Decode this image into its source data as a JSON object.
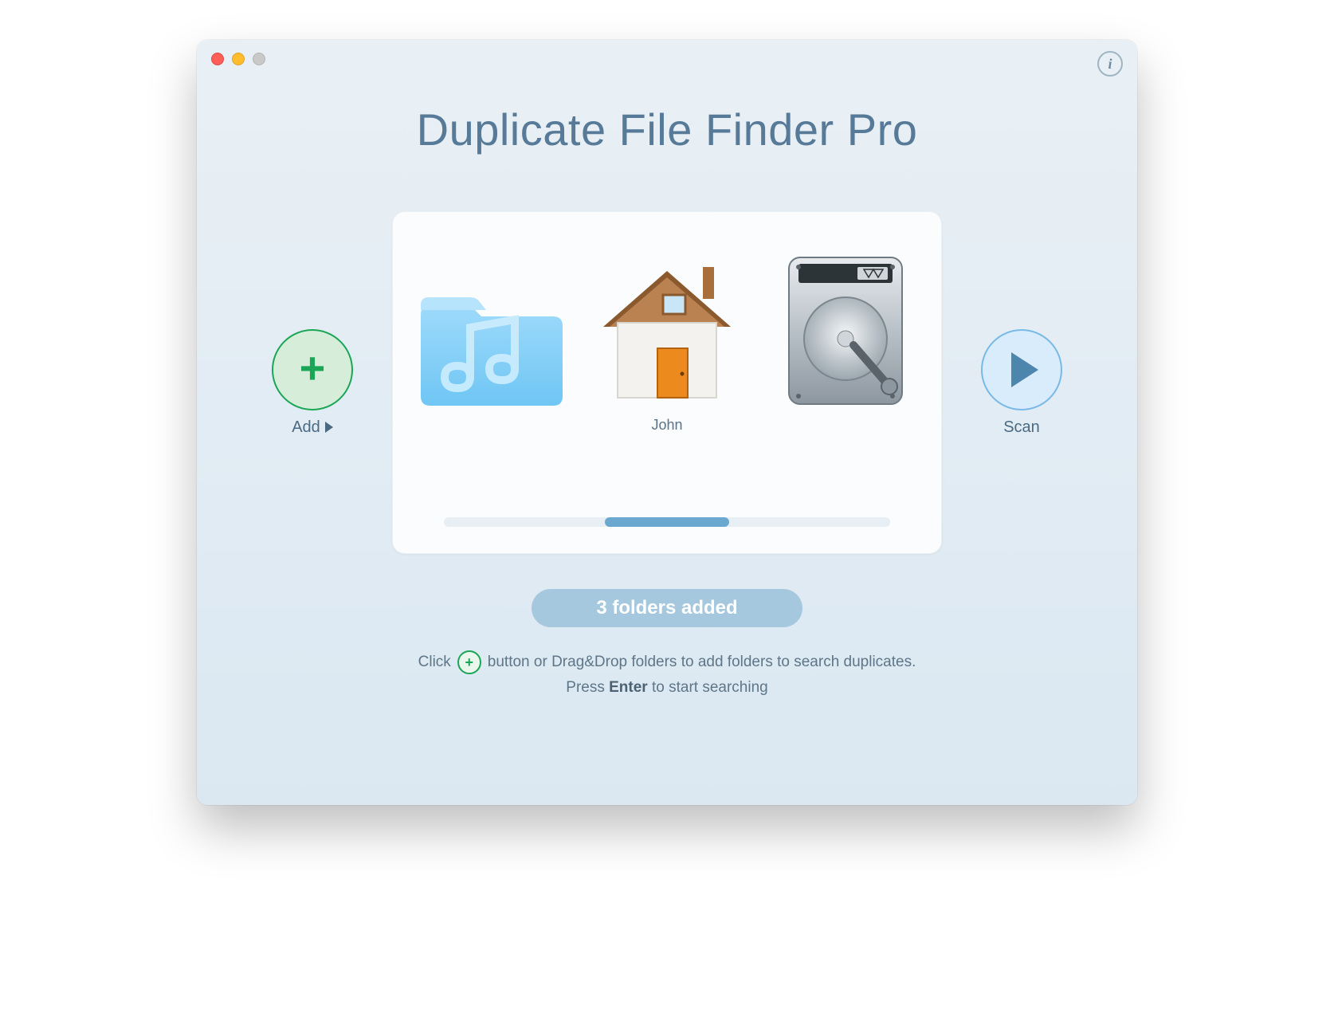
{
  "window": {
    "title": "Duplicate File Finder Pro"
  },
  "buttons": {
    "add_label": "Add",
    "scan_label": "Scan"
  },
  "card": {
    "items": [
      {
        "label": "",
        "type": "music-folder"
      },
      {
        "label": "John",
        "type": "home"
      },
      {
        "label": "",
        "type": "hdd"
      }
    ]
  },
  "status": {
    "pill": "3 folders added"
  },
  "hints": {
    "line1_before": "Click",
    "line1_after": "button or Drag&Drop folders to add folders to search duplicates.",
    "line2_before": "Press",
    "line2_key": "Enter",
    "line2_after": "to start searching"
  }
}
